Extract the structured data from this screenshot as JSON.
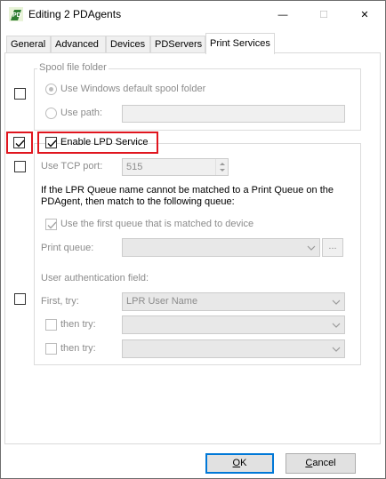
{
  "window": {
    "title": "Editing 2 PDAgents",
    "app_icon_text": "PD",
    "min_glyph": "—",
    "max_glyph": "☐",
    "close_glyph": "✕"
  },
  "tabs": [
    {
      "label": "General",
      "active": false
    },
    {
      "label": "Advanced",
      "active": false
    },
    {
      "label": "Devices",
      "active": false
    },
    {
      "label": "PDServers",
      "active": false
    },
    {
      "label": "Print Services",
      "active": true
    }
  ],
  "spool": {
    "caption": "Spool file folder",
    "default_label": "Use Windows default spool folder",
    "path_label": "Use path:",
    "path_value": "",
    "override_checked": false
  },
  "lpd": {
    "enable_label": "Enable LPD Service",
    "enable_checked": true,
    "override_checked": true,
    "tcp_port_label": "Use TCP port:",
    "tcp_port_value": "515",
    "tcp_override_checked": false,
    "queue_info_line1": "If the LPR Queue name cannot be matched to a Print Queue on the",
    "queue_info_line2": "PDAgent, then match to the following queue:",
    "first_queue_label": "Use the first queue that is matched to device",
    "first_queue_checked": true,
    "print_queue_label": "Print queue:",
    "print_queue_value": "",
    "browse_label": "...",
    "auth_caption": "User authentication field:",
    "auth_override_checked": false,
    "first_try_label": "First, try:",
    "first_try_value": "LPR User Name",
    "then_try1_label": "then try:",
    "then_try1_value": "",
    "then_try2_label": "then try:",
    "then_try2_value": ""
  },
  "buttons": {
    "ok_underlined": "O",
    "ok_rest": "K",
    "cancel_underlined": "C",
    "cancel_rest": "ancel"
  },
  "colors": {
    "highlight": "#e0151e",
    "default_button_border": "#0078d7",
    "disabled_text": "#8c8c8c"
  }
}
